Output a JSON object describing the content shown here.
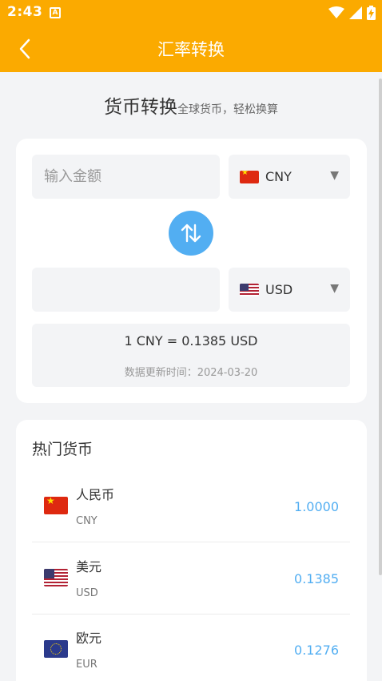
{
  "status_bar": {
    "time": "2:43",
    "notification_badge": "A",
    "icons": [
      "wifi-icon",
      "cell-signal-icon",
      "battery-charging-icon"
    ]
  },
  "app_bar": {
    "title": "汇率转换",
    "back_icon": "chevron-left-icon",
    "background_color": "#fbaa00"
  },
  "hero": {
    "title": "货币转换",
    "subtitle": "全球货币，轻松换算"
  },
  "converter": {
    "amount_value": "",
    "amount_placeholder": "输入金额",
    "from_currency": {
      "code": "CNY",
      "flag": "flag-cn"
    },
    "to_currency": {
      "code": "USD",
      "flag": "flag-us"
    },
    "result_value": "",
    "swap_icon": "swap-vertical-arrows-icon",
    "swap_color": "#52aef2",
    "rate_text": "1 CNY = 0.1385 USD",
    "update_text": "数据更新时间：2024-03-20"
  },
  "popular": {
    "title": "热门货币",
    "items": [
      {
        "name": "人民币",
        "code": "CNY",
        "value": "1.0000",
        "flag": "flag-cn"
      },
      {
        "name": "美元",
        "code": "USD",
        "value": "0.1385",
        "flag": "flag-us"
      },
      {
        "name": "欧元",
        "code": "EUR",
        "value": "0.1276",
        "flag": "flag-eu"
      }
    ],
    "value_color": "#52aef2"
  }
}
